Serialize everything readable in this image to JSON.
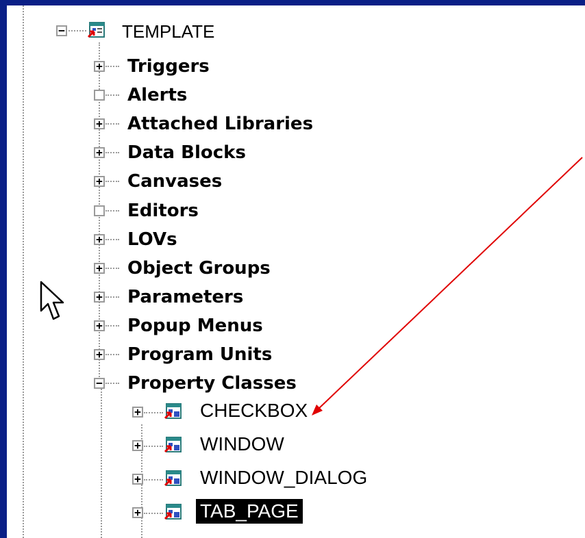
{
  "tree": {
    "root": {
      "label": "TEMPLATE",
      "icon": "form-module-icon"
    },
    "nodes": [
      {
        "label": "Triggers",
        "expander": "+"
      },
      {
        "label": "Alerts",
        "expander": ""
      },
      {
        "label": "Attached Libraries",
        "expander": "+"
      },
      {
        "label": "Data Blocks",
        "expander": "+"
      },
      {
        "label": "Canvases",
        "expander": "+"
      },
      {
        "label": "Editors",
        "expander": ""
      },
      {
        "label": "LOVs",
        "expander": "+"
      },
      {
        "label": "Object Groups",
        "expander": "+"
      },
      {
        "label": "Parameters",
        "expander": "+"
      },
      {
        "label": "Popup Menus",
        "expander": "+"
      },
      {
        "label": "Program Units",
        "expander": "+"
      },
      {
        "label": "Property Classes",
        "expander": "−"
      }
    ],
    "property_classes": [
      {
        "label": "CHECKBOX",
        "expander": "+",
        "icon": "property-class-icon"
      },
      {
        "label": "WINDOW",
        "expander": "+",
        "icon": "property-class-icon"
      },
      {
        "label": "WINDOW_DIALOG",
        "expander": "+",
        "icon": "property-class-icon"
      },
      {
        "label": "TAB_PAGE",
        "expander": "+",
        "icon": "property-class-icon",
        "selected": true
      }
    ]
  },
  "colors": {
    "frame_blue": "#0a1f86",
    "annotation_arrow": "#e00000",
    "selection_bg": "#000000",
    "selection_text": "#ffffff"
  }
}
